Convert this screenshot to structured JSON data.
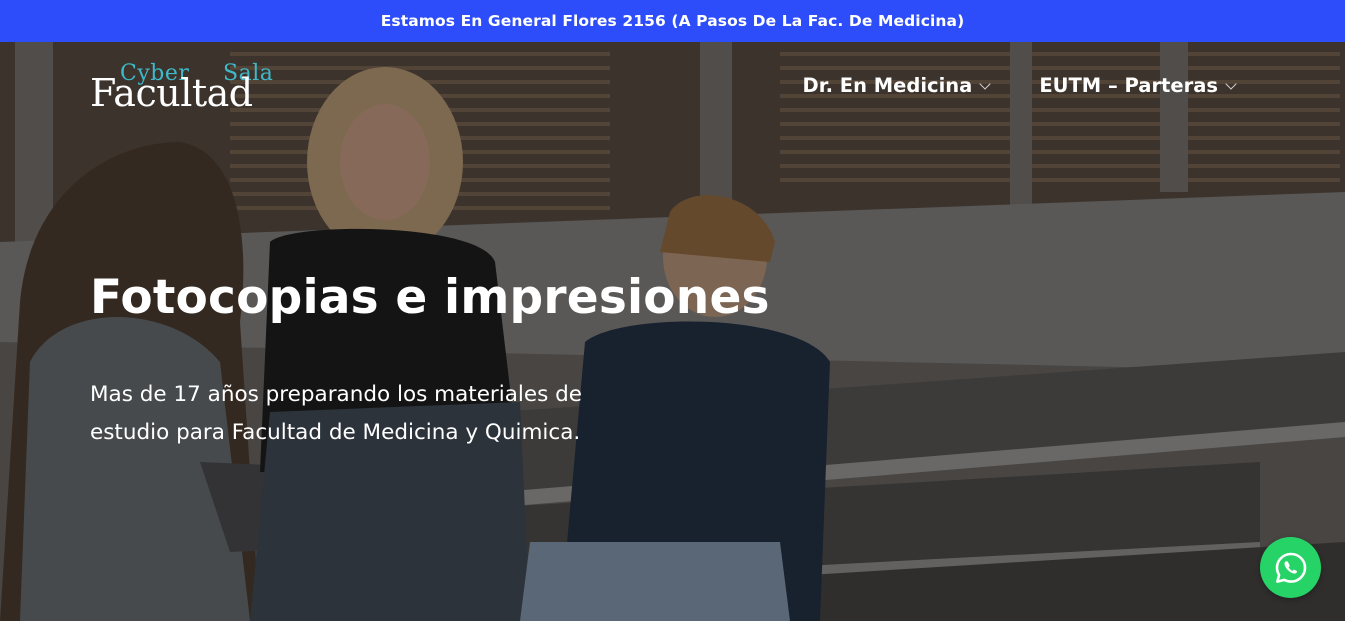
{
  "announcement": "Estamos En General Flores 2156 (A Pasos De La Fac. De Medicina)",
  "logo": {
    "top_left": "Cyber",
    "top_right": "Sala",
    "main": "Facultad"
  },
  "nav": [
    {
      "label": "Dr. En Medicina",
      "icon": "chevron-down-icon"
    },
    {
      "label": "EUTM – Parteras",
      "icon": "chevron-down-icon"
    }
  ],
  "hero": {
    "title": "Fotocopias e impresiones",
    "subtitle": "Mas de 17 años preparando los materiales de estudio para Facultad de Medicina y Quimica."
  },
  "whatsapp": {
    "icon": "whatsapp-icon"
  },
  "colors": {
    "announcement_bg": "#2d4dfa",
    "logo_accent": "#3fb9c9",
    "whatsapp": "#25d366"
  }
}
